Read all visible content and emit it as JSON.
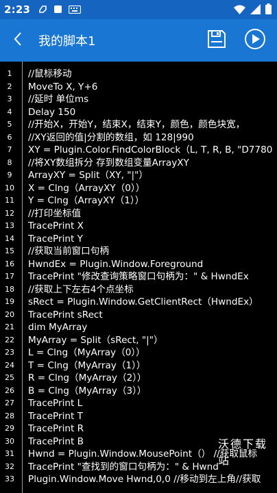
{
  "status_bar": {
    "time": "2:23"
  },
  "app_bar": {
    "title": "我的脚本1",
    "back_icon": "chevron-left-icon",
    "save_icon": "floppy-disk-icon",
    "run_icon": "play-icon"
  },
  "editor": {
    "lines": [
      {
        "num": "1",
        "text": "//鼠标移动"
      },
      {
        "num": "2",
        "text": "MoveTo X, Y+6"
      },
      {
        "num": "3",
        "text": "//延时 单位ms"
      },
      {
        "num": "4",
        "text": "Delay 150"
      },
      {
        "num": "5",
        "text": "//开始X，开始Y，结束X，结束Y，颜色，颜色块宽，"
      },
      {
        "num": "6",
        "text": "//XY返回的值|分割的数组，如 128|990"
      },
      {
        "num": "7",
        "text": "XY = Plugin.Color.FindColorBlock（L, T, R, B, \"D7780"
      },
      {
        "num": "8",
        "text": "//将XY数组拆分 存到数组变量ArrayXY"
      },
      {
        "num": "9",
        "text": "ArrayXY = Split（XY, \"|\"）"
      },
      {
        "num": "10",
        "text": "X = Clng（ArrayXY（0））"
      },
      {
        "num": "11",
        "text": "Y = Clng（ArrayXY（1））"
      },
      {
        "num": "12",
        "text": "//打印坐标值"
      },
      {
        "num": "13",
        "text": "TracePrint X"
      },
      {
        "num": "14",
        "text": "TracePrint Y"
      },
      {
        "num": "15",
        "text": "//获取当前窗口句柄"
      },
      {
        "num": "16",
        "text": "HwndEx = Plugin.Window.Foreground"
      },
      {
        "num": "17",
        "text": "TracePrint \"修改查询策略窗口句柄为：\" & HwndEx"
      },
      {
        "num": "18",
        "text": "//获取上下左右4个点坐标"
      },
      {
        "num": "19",
        "text": "sRect = Plugin.Window.GetClientRect（HwndEx）"
      },
      {
        "num": "20",
        "text": "TracePrint sRect"
      },
      {
        "num": "21",
        "text": "dim MyArray"
      },
      {
        "num": "22",
        "text": "MyArray = Split（sRect, \"|\"）"
      },
      {
        "num": "23",
        "text": "L = Clng（MyArray（0））"
      },
      {
        "num": "24",
        "text": "T = Clng（MyArray（1））"
      },
      {
        "num": "25",
        "text": "R = Clng（MyArray（2））"
      },
      {
        "num": "26",
        "text": "B = Clng（MyArray（3））"
      },
      {
        "num": "27",
        "text": "TracePrint L"
      },
      {
        "num": "28",
        "text": "TracePrint T"
      },
      {
        "num": "29",
        "text": "TracePrint R"
      },
      {
        "num": "30",
        "text": "TracePrint B"
      },
      {
        "num": "31",
        "text": "Hwnd = Plugin.Window.MousePoint（） //获取鼠标"
      },
      {
        "num": "32",
        "text": "TracePrint \"查找到的窗口句柄为：\" & Hwnd"
      },
      {
        "num": "33",
        "text": "Plugin.Window.Move Hwnd,0,0 //移动到左上角//获取"
      }
    ]
  },
  "watermark": "沃德下载站",
  "colors": {
    "status_bar": "#1565c0",
    "app_bar": "#1976d2",
    "editor_bg": "#000000",
    "text": "#ffffff"
  }
}
